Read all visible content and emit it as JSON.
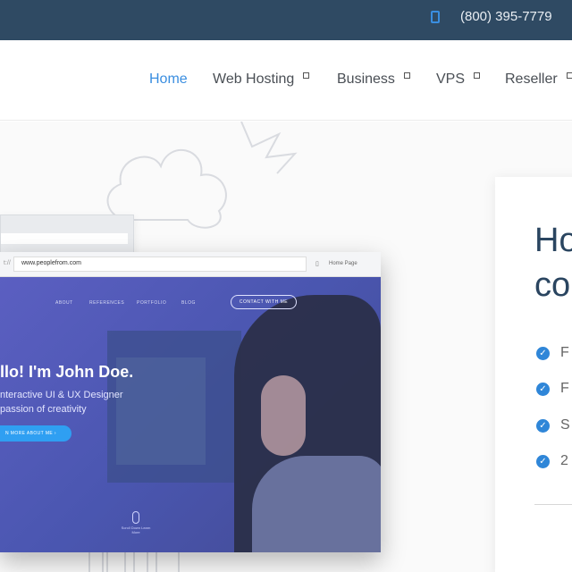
{
  "topbar": {
    "phone_icon": "phone-icon",
    "phone": "(800) 395-7779"
  },
  "nav": {
    "items": [
      {
        "label": "Home",
        "active": true,
        "has_dropdown": false
      },
      {
        "label": "Web Hosting",
        "active": false,
        "has_dropdown": true
      },
      {
        "label": "Business",
        "active": false,
        "has_dropdown": true
      },
      {
        "label": "VPS",
        "active": false,
        "has_dropdown": true
      },
      {
        "label": "Reseller",
        "active": false,
        "has_dropdown": true
      }
    ]
  },
  "browser_mockup": {
    "url_prefix": "t://",
    "url": "www.peoplefrom.com",
    "tab_title": "Home Page",
    "site": {
      "menu": [
        "ABOUT",
        "REFERENCES",
        "PORTFOLIO",
        "BLOG"
      ],
      "contact_button": "CONTACT WITH ME",
      "headline": "llo! I'm John Doe.",
      "subline_1": "nteractive UI & UX Designer",
      "subline_2": "passion of creativity",
      "cta": "N MORE ABOUT ME ›",
      "scroll_hint": "Scroll Down Learn More"
    }
  },
  "card": {
    "title_line_1": "Ho",
    "title_line_2": "co",
    "features": [
      "F",
      "F",
      "S",
      "2"
    ]
  },
  "colors": {
    "topbar": "#2f4a63",
    "accent": "#3a8ee0",
    "heading": "#2a4560",
    "site_gradient": "#5b5fc1"
  }
}
